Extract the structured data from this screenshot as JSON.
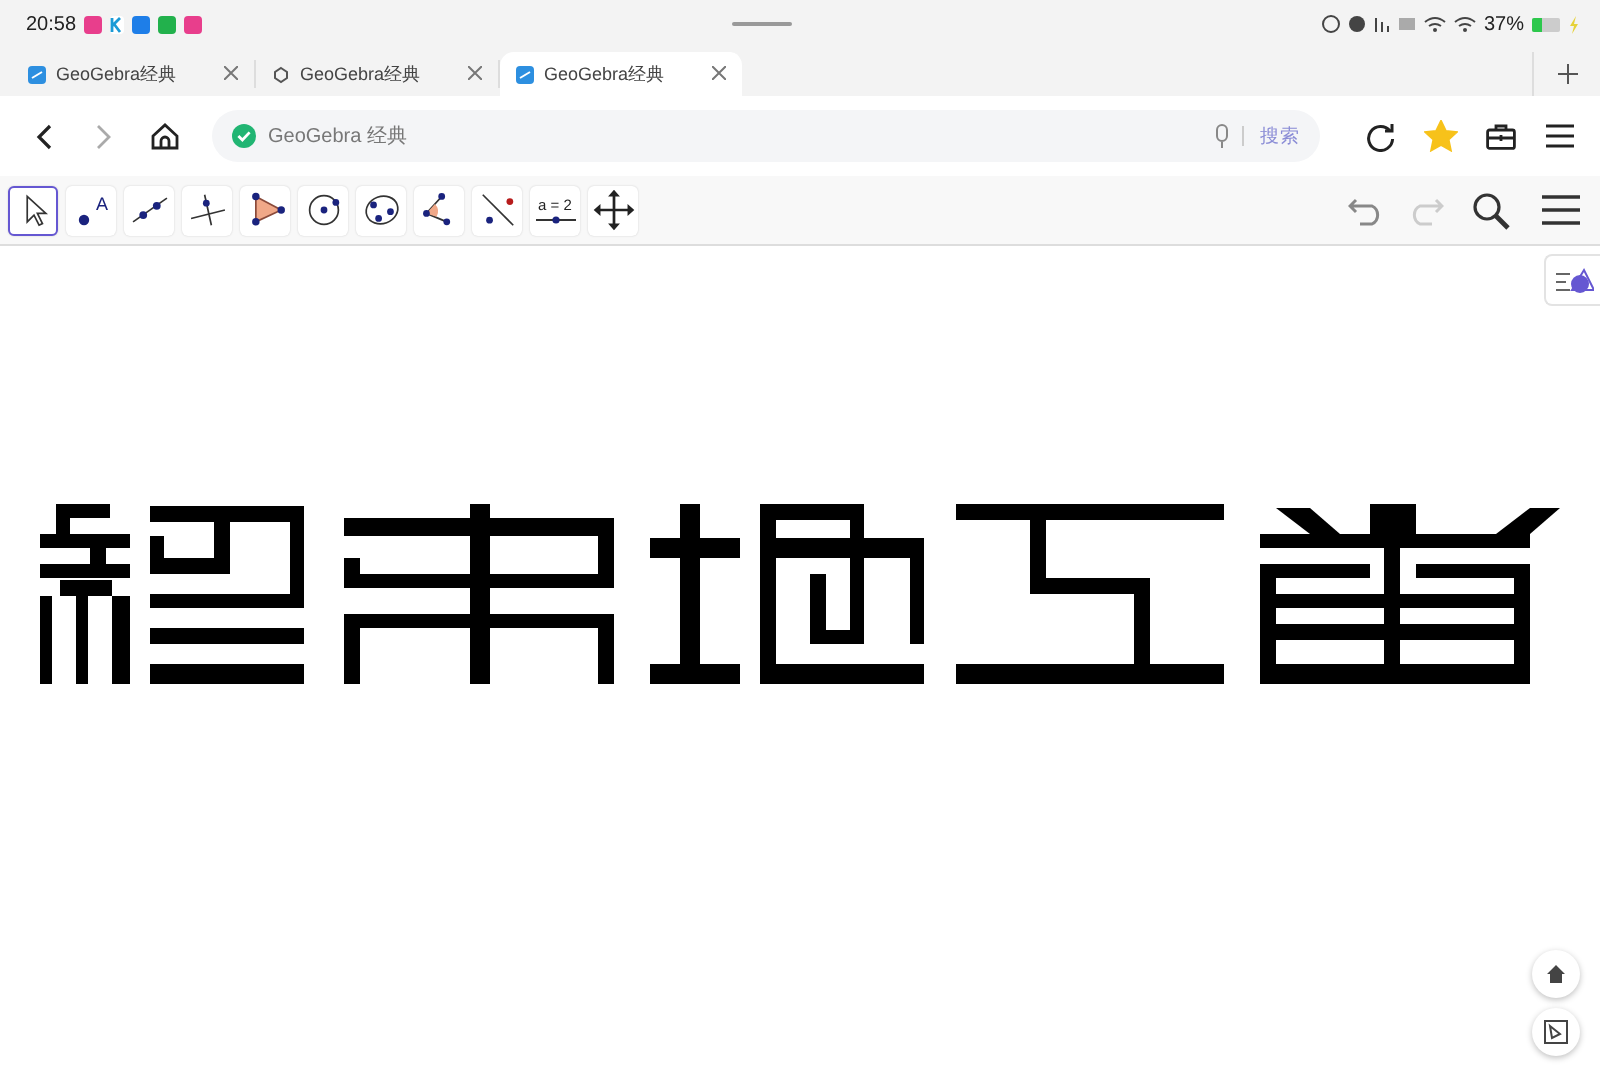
{
  "status_bar": {
    "time": "20:58",
    "battery_text": "37%",
    "battery": {
      "level": 0.37
    }
  },
  "tabs": [
    {
      "title": "GeoGebra经典",
      "selected": false
    },
    {
      "title": "GeoGebra经典",
      "selected": false
    },
    {
      "title": "GeoGebra经典",
      "selected": true
    }
  ],
  "address_bar": {
    "value": "GeoGebra 经典",
    "search_button": "搜索",
    "favorited": true
  },
  "toolbar": {
    "tools": [
      {
        "kind": "move",
        "selected": true
      },
      {
        "kind": "point",
        "selected": false,
        "label": "A"
      },
      {
        "kind": "line",
        "selected": false
      },
      {
        "kind": "perpendicular",
        "selected": false
      },
      {
        "kind": "polygon",
        "selected": false
      },
      {
        "kind": "circle",
        "selected": false
      },
      {
        "kind": "conic",
        "selected": false
      },
      {
        "kind": "angle",
        "selected": false
      },
      {
        "kind": "reflect",
        "selected": false
      },
      {
        "kind": "slider",
        "selected": false,
        "label": "a = 2"
      },
      {
        "kind": "pan",
        "selected": false
      }
    ]
  }
}
